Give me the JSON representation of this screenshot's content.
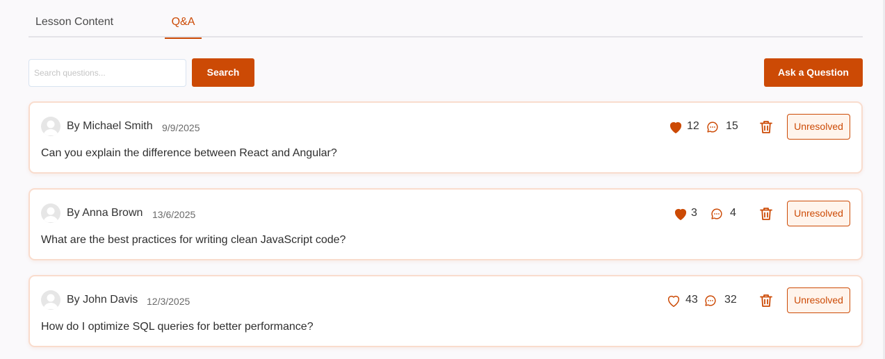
{
  "tabs": [
    {
      "label": "Lesson Content"
    },
    {
      "label": "Q&A"
    }
  ],
  "search": {
    "placeholder": "Search questions...",
    "value": "",
    "button_label": "Search"
  },
  "ask_button_label": "Ask a Question",
  "colors": {
    "accent": "#cc4a05",
    "card_border": "#f9dccd",
    "badge_bg": "#fff4ec"
  },
  "questions": [
    {
      "author": "By Michael Smith",
      "date": "9/9/2025",
      "text": "Can you explain the difference between React and Angular?",
      "likes": "12",
      "liked": true,
      "comments": "15",
      "status": "Unresolved"
    },
    {
      "author": "By Anna Brown",
      "date": "13/6/2025",
      "text": "What are the best practices for writing clean JavaScript code?",
      "likes": "3",
      "liked": true,
      "comments": "4",
      "status": "Unresolved"
    },
    {
      "author": "By John Davis",
      "date": "12/3/2025",
      "text": "How do I optimize SQL queries for better performance?",
      "likes": "43",
      "liked": false,
      "comments": "32",
      "status": "Unresolved"
    }
  ]
}
